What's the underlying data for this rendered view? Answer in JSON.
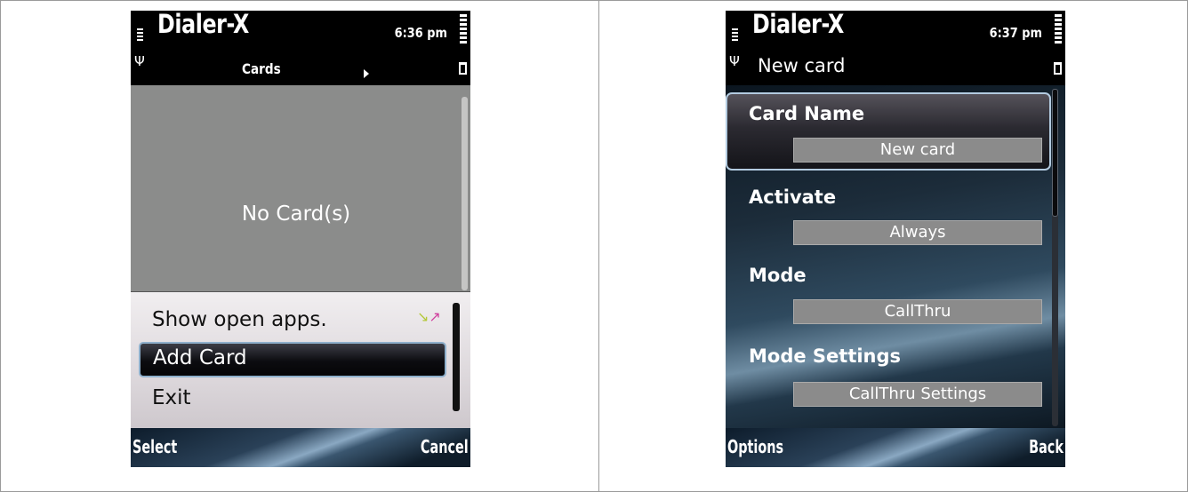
{
  "left_screen": {
    "app_name": "Dialer-X",
    "time": "6:36 pm",
    "tab_title": "Cards",
    "empty_message": "No Card(s)",
    "menu": {
      "items": [
        "Show open apps.",
        "Add Card",
        "Exit"
      ],
      "selected": "Add Card"
    },
    "softkeys": {
      "left": "Select",
      "right": "Cancel"
    }
  },
  "right_screen": {
    "app_name": "Dialer-X",
    "time": "6:37 pm",
    "title": "New card",
    "fields": [
      {
        "label": "Card Name",
        "value": "New card"
      },
      {
        "label": "Activate",
        "value": "Always"
      },
      {
        "label": "Mode",
        "value": "CallThru"
      },
      {
        "label": "Mode Settings",
        "value": "CallThru Settings"
      }
    ],
    "selected_field": "Card Name",
    "softkeys": {
      "left": "Options",
      "right": "Back"
    }
  },
  "colors": {
    "menu_highlight_border": "#8fb0cc",
    "content_gray": "#8b8c8b",
    "field_box": "#8b8b8b"
  }
}
